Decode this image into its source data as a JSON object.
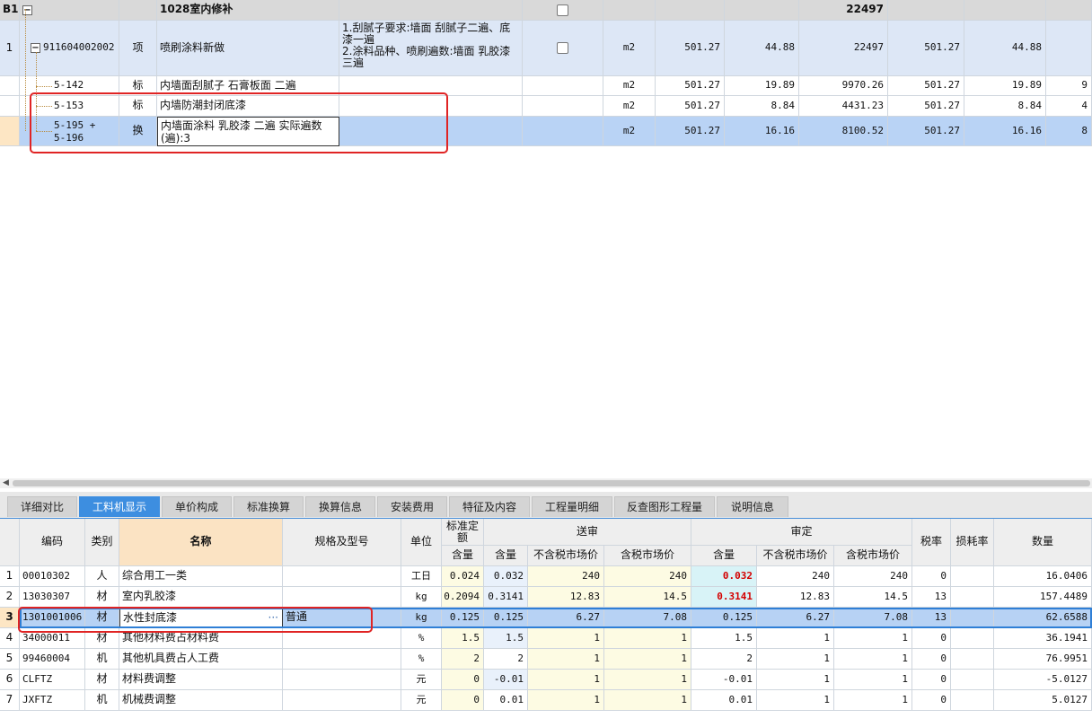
{
  "upper": {
    "header_row": {
      "code": "B1",
      "name": "1028室内修补",
      "total": "22497"
    },
    "rows": [
      {
        "num": "1",
        "code": "911604002002",
        "type": "项",
        "name": "喷刷涂料新做",
        "desc": [
          "1.刮腻子要求:墙面 刮腻子二遍、底",
          "漆一遍",
          "2.涂料品种、喷刷遍数:墙面 乳胶漆",
          "三遍"
        ],
        "unit": "m2",
        "qty": "501.27",
        "price": "44.88",
        "total": "22497",
        "qty2": "501.27",
        "price2": "44.88",
        "extra": ""
      },
      {
        "num": "",
        "code": "5-142",
        "type": "标",
        "name": "内墙面刮腻子 石膏板面 二遍",
        "desc": [],
        "unit": "m2",
        "qty": "501.27",
        "price": "19.89",
        "total": "9970.26",
        "qty2": "501.27",
        "price2": "19.89",
        "extra": "9"
      },
      {
        "num": "",
        "code": "5-153",
        "type": "标",
        "name": "内墙防潮封闭底漆",
        "desc": [],
        "unit": "m2",
        "qty": "501.27",
        "price": "8.84",
        "total": "4431.23",
        "qty2": "501.27",
        "price2": "8.84",
        "extra": "4"
      },
      {
        "num": "",
        "code": "5-195 +",
        "code2": "5-196",
        "type": "换",
        "name": "内墙面涂料 乳胶漆 二遍  实际遍数",
        "name2": "(遍):3",
        "desc": [],
        "unit": "m2",
        "qty": "501.27",
        "price": "16.16",
        "total": "8100.52",
        "qty2": "501.27",
        "price2": "16.16",
        "extra": "8"
      }
    ]
  },
  "tabs": [
    "详细对比",
    "工料机显示",
    "单价构成",
    "标准换算",
    "换算信息",
    "安装费用",
    "特征及内容",
    "工程量明细",
    "反查图形工程量",
    "说明信息"
  ],
  "active_tab": "工料机显示",
  "lower": {
    "headers": {
      "code": "编码",
      "category": "类别",
      "name": "名称",
      "spec": "规格及型号",
      "unit": "单位",
      "std_qty": "标准定额",
      "std_sub": "含量",
      "submit": "送审",
      "submit_qty": "含量",
      "submit_price_ex": "不含税市场价",
      "submit_price_in": "含税市场价",
      "approve": "审定",
      "approve_qty": "含量",
      "approve_price_ex": "不含税市场价",
      "approve_price_in": "含税市场价",
      "tax": "税率",
      "loss": "损耗率",
      "amount": "数量"
    },
    "rows": [
      {
        "n": "1",
        "code": "00010302",
        "cat": "人",
        "name": "综合用工一类",
        "spec": "",
        "unit": "工日",
        "std": "0.024",
        "sq": "0.032",
        "spx": "240",
        "spi": "240",
        "aq": "0.032",
        "apx": "240",
        "api": "240",
        "tax": "0",
        "loss": "",
        "amt": "16.0406"
      },
      {
        "n": "2",
        "code": "13030307",
        "cat": "材",
        "name": "室内乳胶漆",
        "spec": "",
        "unit": "kg",
        "std": "0.2094",
        "sq": "0.3141",
        "spx": "12.83",
        "spi": "14.5",
        "aq": "0.3141",
        "apx": "12.83",
        "api": "14.5",
        "tax": "13",
        "loss": "",
        "amt": "157.4489"
      },
      {
        "n": "3",
        "code": "1301001006",
        "cat": "材",
        "name": "水性封底漆",
        "spec": "普通",
        "unit": "kg",
        "std": "0.125",
        "sq": "0.125",
        "spx": "6.27",
        "spi": "7.08",
        "aq": "0.125",
        "apx": "6.27",
        "api": "7.08",
        "tax": "13",
        "loss": "",
        "amt": "62.6588"
      },
      {
        "n": "4",
        "code": "34000011",
        "cat": "材",
        "name": "其他材料费占材料费",
        "spec": "",
        "unit": "%",
        "std": "1.5",
        "sq": "1.5",
        "spx": "1",
        "spi": "1",
        "aq": "1.5",
        "apx": "1",
        "api": "1",
        "tax": "0",
        "loss": "",
        "amt": "36.1941"
      },
      {
        "n": "5",
        "code": "99460004",
        "cat": "机",
        "name": "其他机具费占人工费",
        "spec": "",
        "unit": "%",
        "std": "2",
        "sq": "2",
        "spx": "1",
        "spi": "1",
        "aq": "2",
        "apx": "1",
        "api": "1",
        "tax": "0",
        "loss": "",
        "amt": "76.9951"
      },
      {
        "n": "6",
        "code": "CLFTZ",
        "cat": "材",
        "name": "材料费调整",
        "spec": "",
        "unit": "元",
        "std": "0",
        "sq": "-0.01",
        "spx": "1",
        "spi": "1",
        "aq": "-0.01",
        "apx": "1",
        "api": "1",
        "tax": "0",
        "loss": "",
        "amt": "-5.0127"
      },
      {
        "n": "7",
        "code": "JXFTZ",
        "cat": "机",
        "name": "机械费调整",
        "spec": "",
        "unit": "元",
        "std": "0",
        "sq": "0.01",
        "spx": "1",
        "spi": "1",
        "aq": "0.01",
        "apx": "1",
        "api": "1",
        "tax": "0",
        "loss": "",
        "amt": "5.0127"
      }
    ],
    "ellipsis": "···"
  },
  "colors": {
    "selected": "#b7d2f4",
    "highlight_red": "#d40000",
    "annotation_box": "#e02424",
    "active_tab": "#3d8ee0"
  }
}
